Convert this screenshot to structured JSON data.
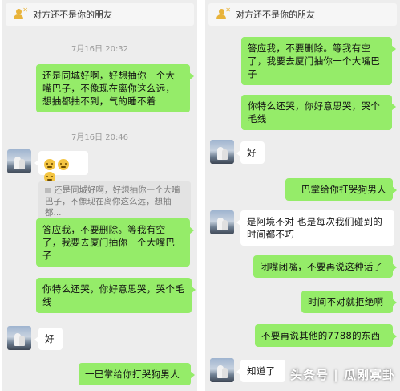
{
  "banner_text": "对方还不是你的朋友",
  "left": {
    "time1": "7月16日 20:32",
    "msg1": "还是同城好啊，好想抽你一个大嘴巴子，不像现在离你这么远，想抽都抽不到，气的睡不着",
    "time2": "7月16日 20:46",
    "emoji_count": 3,
    "quote": "还是同城好啊，好想抽你一个大嘴巴子，不像现在离你这么远，想抽都...",
    "msg2": "答应我，不要删除。等我有空了，我要去厦门抽你一个大嘴巴子",
    "msg3": "你特么还哭，你好意思哭，哭个毛线",
    "msg4": "好",
    "msg5": "一巴掌给你打哭狗男人"
  },
  "right": {
    "msg1": "答应我，不要删除。等我有空了，我要去厦门抽你一个大嘴巴子",
    "msg2": "你特么还哭，你好意思哭，哭个毛线",
    "msg3": "好",
    "msg4": "一巴掌给你打哭狗男人",
    "msg5": "是阿境不对 也是每次我们碰到的时间都不巧",
    "msg6": "闭嘴闭嘴，不要再说这种话了",
    "msg7": "时间不对就拒绝啊",
    "msg8": "不要再说其他的7788的东西",
    "msg9": "知道了"
  },
  "watermark": "头条号 | 瓜剐寡卦"
}
